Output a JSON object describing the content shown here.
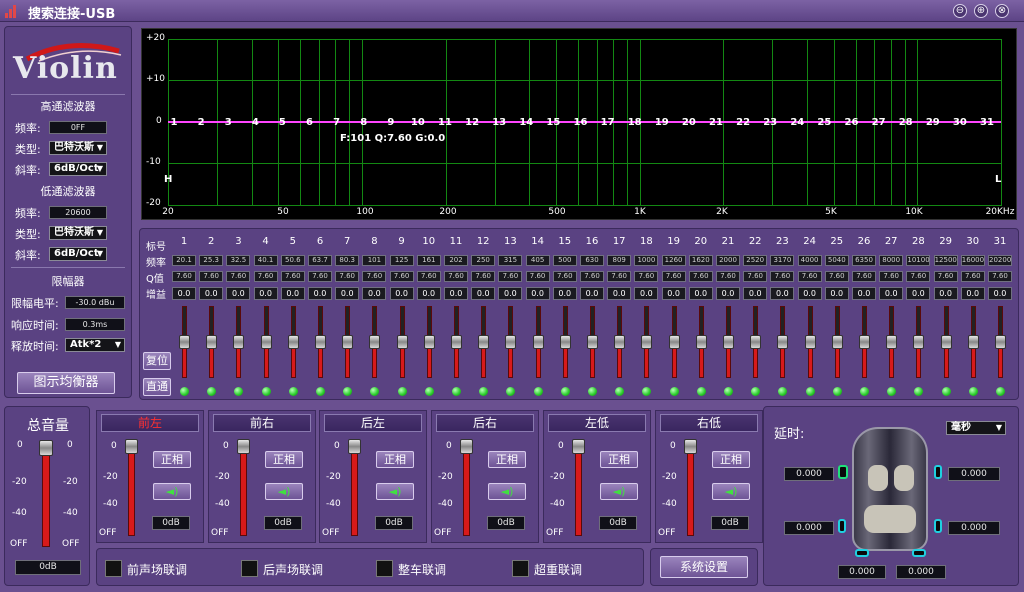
{
  "window": {
    "title": "搜索连接-USB",
    "buttons": [
      "⊖",
      "⊕",
      "⊗"
    ]
  },
  "brand": {
    "logo_text": "Violin"
  },
  "highpass": {
    "title": "高通滤波器",
    "freq_label": "频率:",
    "freq_value": "0FF",
    "type_label": "类型:",
    "type_value": "巴特沃斯",
    "slope_label": "斜率:",
    "slope_value": "6dB/Oct"
  },
  "lowpass": {
    "title": "低通滤波器",
    "freq_label": "频率:",
    "freq_value": "20600",
    "type_label": "类型:",
    "type_value": "巴特沃斯",
    "slope_label": "斜率:",
    "slope_value": "6dB/Oct"
  },
  "limiter": {
    "title": "限幅器",
    "level_label": "限幅电平:",
    "level_value": "-30.0 dBu",
    "attack_label": "响应时间:",
    "attack_value": "0.3ms",
    "release_label": "释放时间:",
    "release_value": "Atk*2"
  },
  "eq_button": "图示均衡器",
  "graph": {
    "y_ticks": [
      "+20",
      "+10",
      "0",
      "-10",
      "-20"
    ],
    "x_ticks": [
      "20",
      "50",
      "100",
      "200",
      "500",
      "1K",
      "2K",
      "5K",
      "10K",
      "20KHz"
    ],
    "readout": "F:101 Q:7.60 G:0.0",
    "left_marker": "H",
    "right_marker": "L",
    "curve_color": "#ff44ff",
    "grid_color": "#138813"
  },
  "eq_table": {
    "row_labels": [
      "标号",
      "频率",
      "Q值",
      "增益"
    ],
    "bands": [
      "1",
      "2",
      "3",
      "4",
      "5",
      "6",
      "7",
      "8",
      "9",
      "10",
      "11",
      "12",
      "13",
      "14",
      "15",
      "16",
      "17",
      "18",
      "19",
      "20",
      "21",
      "22",
      "23",
      "24",
      "25",
      "26",
      "27",
      "28",
      "29",
      "30",
      "31"
    ],
    "freqs": [
      "20.1",
      "25.3",
      "32.5",
      "40.1",
      "50.6",
      "63.7",
      "80.3",
      "101",
      "125",
      "161",
      "202",
      "250",
      "315",
      "405",
      "500",
      "630",
      "809",
      "1000",
      "1260",
      "1620",
      "2000",
      "2520",
      "3170",
      "4000",
      "5040",
      "6350",
      "8000",
      "10100",
      "12500",
      "16000",
      "20200"
    ],
    "q": [
      "7.60",
      "7.60",
      "7.60",
      "7.60",
      "7.60",
      "7.60",
      "7.60",
      "7.60",
      "7.60",
      "7.60",
      "7.60",
      "7.60",
      "7.60",
      "7.60",
      "7.60",
      "7.60",
      "7.60",
      "7.60",
      "7.60",
      "7.60",
      "7.60",
      "7.60",
      "7.60",
      "7.60",
      "7.60",
      "7.60",
      "7.60",
      "7.60",
      "7.60",
      "7.60",
      "7.60"
    ],
    "gains": [
      "0.0",
      "0.0",
      "0.0",
      "0.0",
      "0.0",
      "0.0",
      "0.0",
      "0.0",
      "0.0",
      "0.0",
      "0.0",
      "0.0",
      "0.0",
      "0.0",
      "0.0",
      "0.0",
      "0.0",
      "0.0",
      "0.0",
      "0.0",
      "0.0",
      "0.0",
      "0.0",
      "0.0",
      "0.0",
      "0.0",
      "0.0",
      "0.0",
      "0.0",
      "0.0",
      "0.0"
    ],
    "reset_label": "复位",
    "bypass_label": "直通"
  },
  "master": {
    "title": "总音量",
    "scale": [
      "0",
      "-20",
      "-40",
      "OFF"
    ],
    "value": "0dB"
  },
  "channels": [
    {
      "name": "前左",
      "phase": "正相",
      "value": "0dB",
      "scale": [
        "0",
        "-20",
        "-40",
        "OFF"
      ]
    },
    {
      "name": "前右",
      "phase": "正相",
      "value": "0dB",
      "scale": [
        "0",
        "-20",
        "-40",
        "OFF"
      ]
    },
    {
      "name": "后左",
      "phase": "正相",
      "value": "0dB",
      "scale": [
        "0",
        "-20",
        "-40",
        "OFF"
      ]
    },
    {
      "name": "后右",
      "phase": "正相",
      "value": "0dB",
      "scale": [
        "0",
        "-20",
        "-40",
        "OFF"
      ]
    },
    {
      "name": "左低",
      "phase": "正相",
      "value": "0dB",
      "scale": [
        "0",
        "-20",
        "-40",
        "OFF"
      ]
    },
    {
      "name": "右低",
      "phase": "正相",
      "value": "0dB",
      "scale": [
        "0",
        "-20",
        "-40",
        "OFF"
      ]
    }
  ],
  "links": [
    "前声场联调",
    "后声场联调",
    "整车联调",
    "超重联调"
  ],
  "system_button": "系统设置",
  "delay": {
    "title": "延时:",
    "unit": "毫秒",
    "front_left": "0.000",
    "front_right": "0.000",
    "rear_left": "0.000",
    "rear_right": "0.000",
    "sub_left": "0.000",
    "sub_right": "0.000"
  }
}
